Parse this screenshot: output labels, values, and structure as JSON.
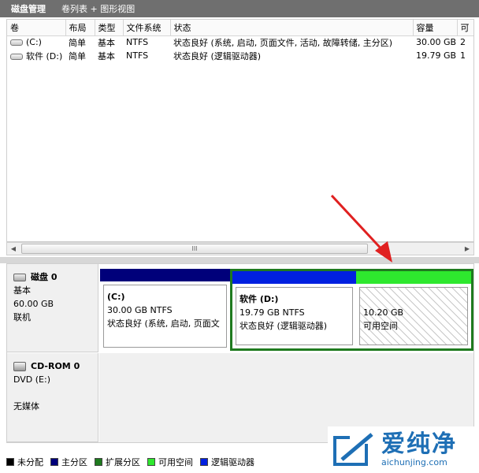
{
  "header": {
    "title": "磁盘管理",
    "view": "卷列表 + 图形视图"
  },
  "columns": [
    "卷",
    "布局",
    "类型",
    "文件系统",
    "状态",
    "容量",
    "可"
  ],
  "volumes": [
    {
      "name": "(C:)",
      "layout": "简单",
      "type": "基本",
      "fs": "NTFS",
      "status": "状态良好 (系统, 启动, 页面文件, 活动, 故障转储, 主分区)",
      "capacity": "30.00 GB",
      "free": "2"
    },
    {
      "name": "软件 (D:)",
      "layout": "简单",
      "type": "基本",
      "fs": "NTFS",
      "status": "状态良好 (逻辑驱动器)",
      "capacity": "19.79 GB",
      "free": "1"
    }
  ],
  "scrollbar": {
    "grip": "III"
  },
  "disk0": {
    "title": "磁盘 0",
    "type": "基本",
    "size": "60.00 GB",
    "state": "联机"
  },
  "partitions": {
    "c": {
      "name": "(C:)",
      "size": "30.00 GB NTFS",
      "status": "状态良好 (系统, 启动, 页面文"
    },
    "d": {
      "name": "软件  (D:)",
      "size": "19.79 GB NTFS",
      "status": "状态良好 (逻辑驱动器)"
    },
    "free": {
      "size": "10.20 GB",
      "status": "可用空间"
    }
  },
  "cdrom": {
    "title": "CD-ROM 0",
    "drive": "DVD (E:)",
    "media": "无媒体"
  },
  "legend": [
    {
      "label": "未分配",
      "color": "#000000"
    },
    {
      "label": "主分区",
      "color": "#00007a"
    },
    {
      "label": "扩展分区",
      "color": "#1f7a1f"
    },
    {
      "label": "可用空间",
      "color": "#2ee82e"
    },
    {
      "label": "逻辑驱动器",
      "color": "#0020e0"
    }
  ],
  "colors": {
    "primary": "#00007a",
    "logical": "#0020e0",
    "free": "#2ee82e",
    "extended": "#1f7a1f",
    "arrow": "#e02020"
  },
  "watermark": {
    "brand": "爱纯净",
    "url": "aichunjing.com"
  }
}
